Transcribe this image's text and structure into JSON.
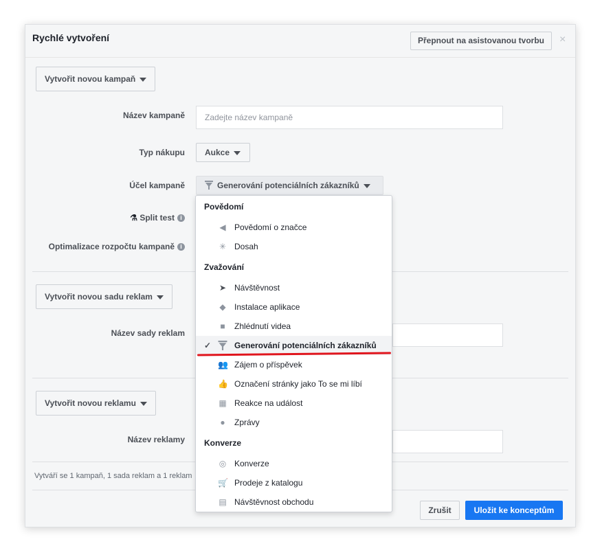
{
  "dialog": {
    "title": "Rychlé vytvoření",
    "switch_button": "Přepnout na asistovanou tvorbu",
    "close": "×"
  },
  "campaign": {
    "dropdown_label": "Vytvořit novou kampaň",
    "name_label": "Název kampaně",
    "name_placeholder": "Zadejte název kampaně",
    "buying_type_label": "Typ nákupu",
    "buying_type_value": "Aukce",
    "objective_label": "Účel kampaně",
    "objective_value": "Generování potenciálních zákazníků",
    "split_test_label": "Split test",
    "budget_opt_label": "Optimalizace rozpočtu kampaně"
  },
  "adset": {
    "dropdown_label": "Vytvořit novou sadu reklam",
    "name_label": "Název sady reklam"
  },
  "ad": {
    "dropdown_label": "Vytvořit novou reklamu",
    "name_label": "Název reklamy"
  },
  "summary": "Vytváří se 1 kampaň, 1 sada reklam a 1 reklam",
  "footer": {
    "cancel": "Zrušit",
    "save": "Uložit ke konceptům"
  },
  "menu": {
    "groups": [
      {
        "heading": "Povědomí",
        "items": [
          {
            "label": "Povědomí o značce",
            "icon": "megaphone-icon"
          },
          {
            "label": "Dosah",
            "icon": "reach-icon"
          }
        ]
      },
      {
        "heading": "Zvažování",
        "items": [
          {
            "label": "Návštěvnost",
            "icon": "cursor-icon"
          },
          {
            "label": "Instalace aplikace",
            "icon": "box-icon"
          },
          {
            "label": "Zhlédnutí videa",
            "icon": "video-icon"
          },
          {
            "label": "Generování potenciálních zákazníků",
            "icon": "funnel-icon",
            "selected": true
          },
          {
            "label": "Zájem o příspěvek",
            "icon": "people-icon"
          },
          {
            "label": "Označení stránky jako To se mi líbí",
            "icon": "thumbs-up-icon"
          },
          {
            "label": "Reakce na událost",
            "icon": "calendar-icon"
          },
          {
            "label": "Zprávy",
            "icon": "chat-icon"
          }
        ]
      },
      {
        "heading": "Konverze",
        "items": [
          {
            "label": "Konverze",
            "icon": "globe-icon"
          },
          {
            "label": "Prodeje z katalogu",
            "icon": "cart-icon"
          },
          {
            "label": "Návštěvnost obchodu",
            "icon": "store-icon"
          }
        ]
      }
    ]
  },
  "colors": {
    "primary": "#1877f2",
    "annotation": "#e0151d"
  }
}
